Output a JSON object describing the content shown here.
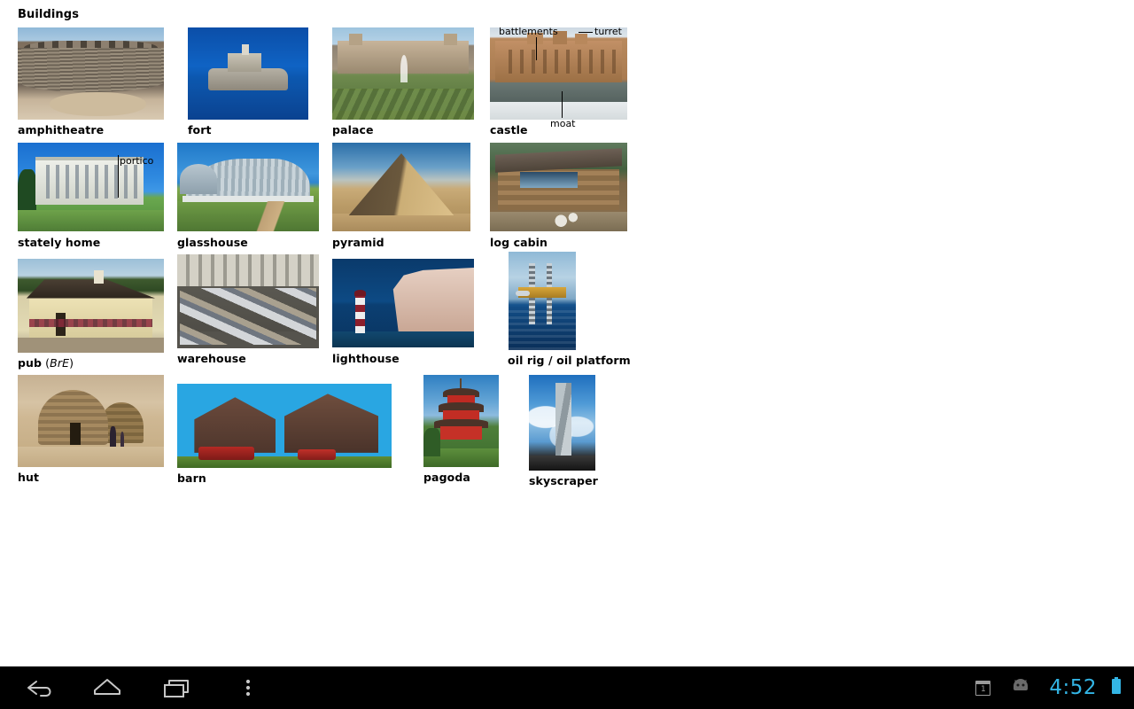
{
  "page": {
    "title": "Buildings",
    "background": "#ffffff"
  },
  "items": [
    {
      "id": "amphitheatre",
      "label": "amphitheatre",
      "annotations": []
    },
    {
      "id": "fort",
      "label": "fort",
      "annotations": []
    },
    {
      "id": "palace",
      "label": "palace",
      "annotations": []
    },
    {
      "id": "castle",
      "label": "castle",
      "annotations": [
        "battlements",
        "turret",
        "moat"
      ]
    },
    {
      "id": "stately-home",
      "label": "stately home",
      "annotations": [
        "portico"
      ]
    },
    {
      "id": "glasshouse",
      "label": "glasshouse",
      "annotations": []
    },
    {
      "id": "pyramid",
      "label": "pyramid",
      "annotations": []
    },
    {
      "id": "log-cabin",
      "label": "log cabin",
      "annotations": []
    },
    {
      "id": "pub",
      "label": "pub",
      "suffix": "(BrE)",
      "annotations": []
    },
    {
      "id": "warehouse",
      "label": "warehouse",
      "annotations": []
    },
    {
      "id": "lighthouse",
      "label": "lighthouse",
      "annotations": []
    },
    {
      "id": "oil-rig",
      "label": "oil rig / oil platform",
      "annotations": []
    },
    {
      "id": "hut",
      "label": "hut",
      "annotations": []
    },
    {
      "id": "barn",
      "label": "barn",
      "annotations": []
    },
    {
      "id": "pagoda",
      "label": "pagoda",
      "annotations": []
    },
    {
      "id": "skyscraper",
      "label": "skyscraper",
      "annotations": []
    }
  ],
  "annotations": {
    "battlements": "battlements",
    "turret": "turret",
    "moat": "moat",
    "portico": "portico"
  },
  "pub_suffix": "(BrE)",
  "pub_suffix_reg": "BrE",
  "pub_open": "(",
  "pub_close": ")",
  "systembar": {
    "back": "back-icon",
    "home": "home-icon",
    "recents": "recent-apps-icon",
    "menu": "overflow-menu-icon",
    "notification_count": "1",
    "android_icon": "android-robot-icon",
    "clock": "4:52",
    "battery": "battery-icon",
    "accent_color": "#33b5e5",
    "background": "#000000"
  }
}
